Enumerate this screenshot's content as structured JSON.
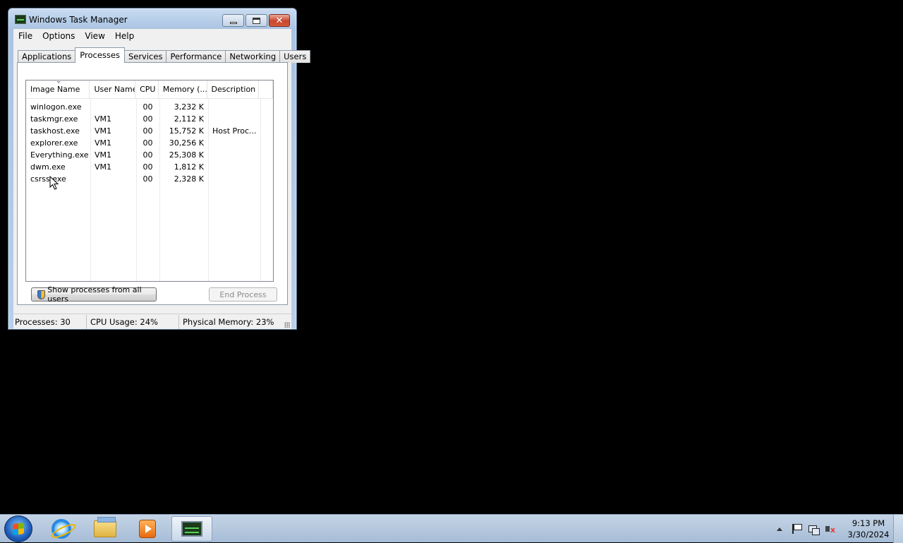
{
  "window": {
    "title": "Windows Task Manager",
    "controls": {
      "minimize": "minimize",
      "maximize": "maximize",
      "close": "✕"
    }
  },
  "menu": [
    "File",
    "Options",
    "View",
    "Help"
  ],
  "tabs": [
    {
      "label": "Applications",
      "active": false
    },
    {
      "label": "Processes",
      "active": true
    },
    {
      "label": "Services",
      "active": false
    },
    {
      "label": "Performance",
      "active": false
    },
    {
      "label": "Networking",
      "active": false
    },
    {
      "label": "Users",
      "active": false
    }
  ],
  "processes": {
    "columns": [
      "Image Name",
      "User Name",
      "CPU",
      "Memory (...",
      "Description"
    ],
    "rows": [
      {
        "image": "winlogon.exe",
        "user": "",
        "cpu": "00",
        "memory": "3,232 K",
        "description": ""
      },
      {
        "image": "taskmgr.exe",
        "user": "VM1",
        "cpu": "00",
        "memory": "2,112 K",
        "description": ""
      },
      {
        "image": "taskhost.exe",
        "user": "VM1",
        "cpu": "00",
        "memory": "15,752 K",
        "description": "Host Proc..."
      },
      {
        "image": "explorer.exe",
        "user": "VM1",
        "cpu": "00",
        "memory": "30,256 K",
        "description": ""
      },
      {
        "image": "Everything.exe",
        "user": "VM1",
        "cpu": "00",
        "memory": "25,308 K",
        "description": ""
      },
      {
        "image": "dwm.exe",
        "user": "VM1",
        "cpu": "00",
        "memory": "1,812 K",
        "description": ""
      },
      {
        "image": "csrss.exe",
        "user": "",
        "cpu": "00",
        "memory": "2,328 K",
        "description": ""
      }
    ]
  },
  "buttons": {
    "show_all": "Show processes from all users",
    "end_process": "End Process"
  },
  "status": {
    "processes": "Processes: 30",
    "cpu": "CPU Usage: 24%",
    "memory": "Physical Memory: 23%"
  },
  "taskbar": {
    "items": [
      "start",
      "internet-explorer",
      "windows-explorer",
      "media-player",
      "task-manager"
    ],
    "clock": {
      "time": "9:13 PM",
      "date": "3/30/2024"
    }
  }
}
